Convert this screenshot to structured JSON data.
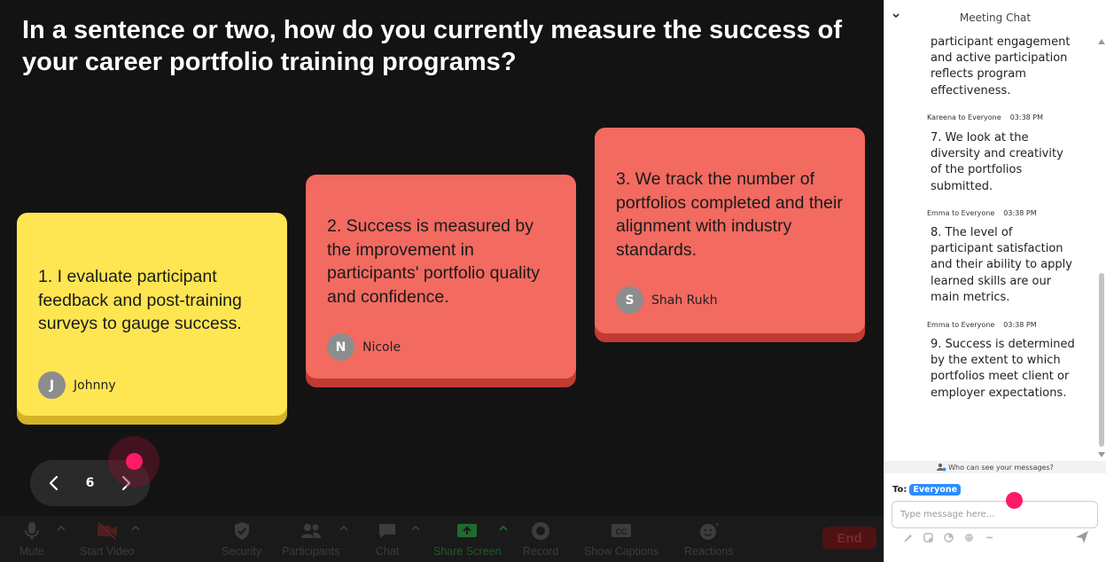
{
  "question": "In a sentence or two, how do you currently measure the success of your career portfolio training programs?",
  "cards": [
    {
      "text": "1. I evaluate participant feedback and post-training surveys to gauge success.",
      "author": "Johnny",
      "initial": "J",
      "color": "#fee552"
    },
    {
      "text": "2. Success is measured by the improvement in participants' portfolio quality and confidence.",
      "author": "Nicole",
      "initial": "N",
      "color": "#f26a60"
    },
    {
      "text": "3. We track the number of portfolios completed and their alignment with industry standards.",
      "author": "Shah Rukh",
      "initial": "S",
      "color": "#f26a60"
    }
  ],
  "pager": {
    "page": "6"
  },
  "toolbar": {
    "mute": "Mute",
    "start_video": "Start Video",
    "security": "Security",
    "participants": "Participants",
    "chat": "Chat",
    "share_screen": "Share Screen",
    "record": "Record",
    "show_captions": "Show Captions",
    "reactions": "Reactions",
    "end": "End"
  },
  "chat": {
    "title": "Meeting Chat",
    "messages": [
      {
        "sender": "",
        "time": "",
        "text": "participant engagement and active participation reflects program effectiveness."
      },
      {
        "sender": "Kareena to Everyone",
        "time": "03:38 PM",
        "text": "7. We look at the diversity and creativity of the portfolios submitted."
      },
      {
        "sender": "Emma to Everyone",
        "time": "03:38 PM",
        "text": "8. The level of participant satisfaction and their ability to apply learned skills are our main metrics."
      },
      {
        "sender": "Emma to Everyone",
        "time": "03:38 PM",
        "text": "9. Success is determined by the extent to which portfolios meet client or employer expectations."
      }
    ],
    "who_can_see": "Who can see your messages?",
    "to_label": "To:",
    "to_value": "Everyone",
    "input_placeholder": "Type message here..."
  },
  "colors": {
    "accent_blue": "#2d8cff",
    "cursor_pink": "#ff1a67",
    "share_green": "#1f6b2e",
    "end_red": "#4e1212"
  }
}
